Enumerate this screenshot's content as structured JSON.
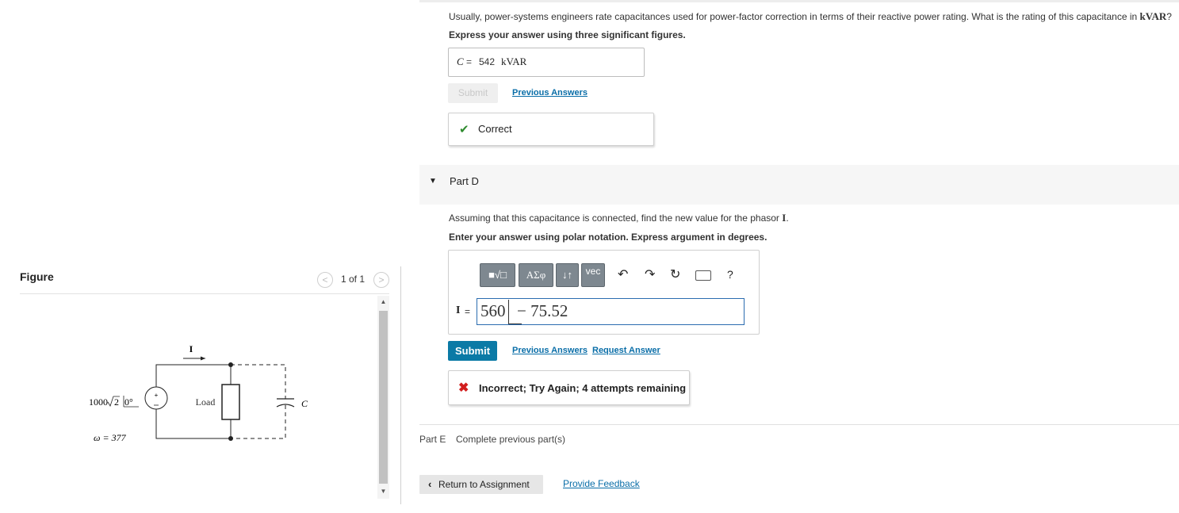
{
  "figure": {
    "title": "Figure",
    "pager": "1 of 1",
    "prev_glyph": "<",
    "next_glyph": ">",
    "circuit": {
      "source_label_prefix": "1000",
      "source_label_radical": "2",
      "source_label_angle": "0°",
      "omega_label": "ω = 377",
      "current_label": "I",
      "load_label": "Load",
      "capacitor_label": "C"
    }
  },
  "part_c": {
    "question_prefix": "Usually, power-systems engineers rate capacitances used for power-factor correction in terms of their reactive power rating. What is the rating of this capacitance in ",
    "question_unit": "kVAR",
    "question_suffix": "?",
    "instruction": "Express your answer using three significant figures.",
    "answer": {
      "variable": "C",
      "equals": "=",
      "value": "542",
      "unit": "kVAR"
    },
    "submit_label": "Submit",
    "previous_answers_label": "Previous Answers",
    "feedback": {
      "icon": "check-icon",
      "text": "Correct",
      "color": "#2e8b2e"
    }
  },
  "part_d": {
    "title": "Part D",
    "question_prefix": "Assuming that this capacitance is connected, find the new value for the phasor ",
    "question_var": "I",
    "question_suffix": ".",
    "instruction": "Enter your answer using polar notation. Express argument in degrees.",
    "toolbar": {
      "template_label": "■√□",
      "greek_label": "ΑΣφ",
      "arrows_label": "↓↑",
      "vec_label": "vec",
      "undo_glyph": "↶",
      "redo_glyph": "↷",
      "reset_glyph": "↻",
      "help_label": "?"
    },
    "answer": {
      "variable": "I",
      "equals": "=",
      "magnitude": "560",
      "angle": "− 75.52"
    },
    "submit_label": "Submit",
    "previous_answers_label": "Previous Answers",
    "request_answer_label": "Request Answer",
    "feedback": {
      "icon": "x-icon",
      "text": "Incorrect; Try Again; 4 attempts remaining",
      "color": "#d21e1e"
    }
  },
  "part_e": {
    "label": "Part E",
    "status": "Complete previous part(s)"
  },
  "footer": {
    "return_label": "Return to Assignment",
    "feedback_label": "Provide Feedback"
  },
  "colors": {
    "accent": "#0b7aa6",
    "link": "#0a6ea8",
    "toolbar": "#7e8890"
  }
}
